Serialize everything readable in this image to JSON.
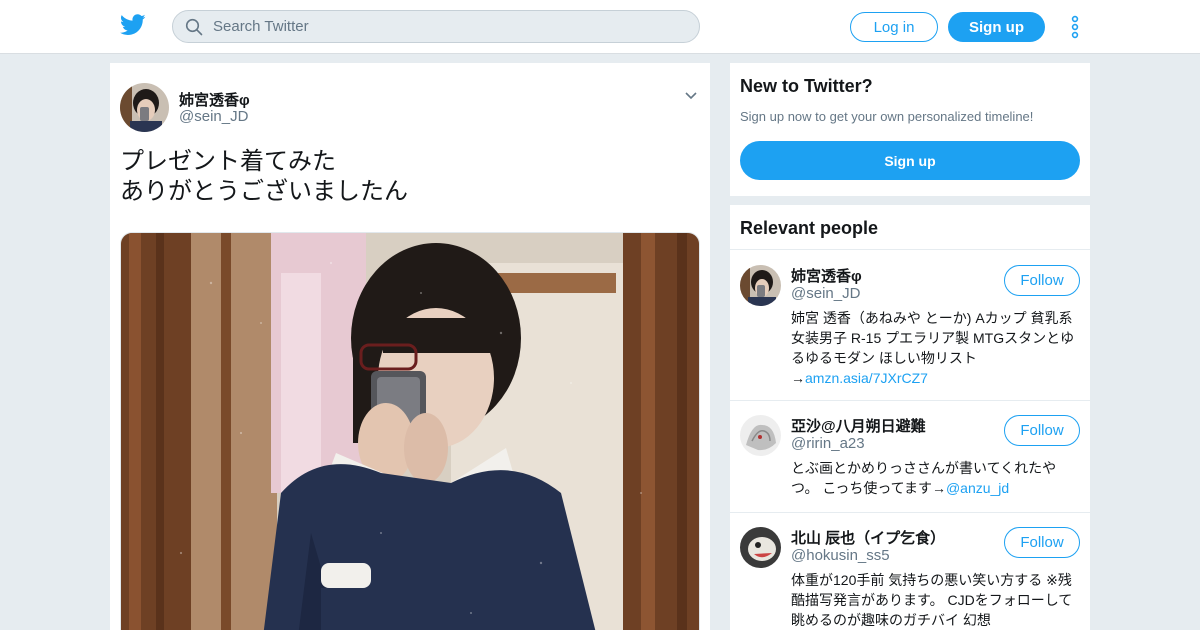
{
  "colors": {
    "brand": "#1da1f2",
    "background": "#e6ecf0",
    "text": "#14171a",
    "muted": "#657786"
  },
  "header": {
    "logo_icon": "twitter-bird-icon",
    "search_placeholder": "Search Twitter",
    "login_label": "Log in",
    "signup_label": "Sign up",
    "more_icon": "more-vertical-icon"
  },
  "tweet": {
    "author_name": "姉宮透香φ",
    "author_handle": "@sein_JD",
    "text": "プレゼント着てみた\nありがとうございましたん",
    "menu_icon": "chevron-down-icon"
  },
  "signup_card": {
    "title": "New to Twitter?",
    "subtitle": "Sign up now to get your own personalized timeline!",
    "button_label": "Sign up"
  },
  "relevant_people": {
    "title": "Relevant people",
    "people": [
      {
        "name": "姉宮透香φ",
        "handle": "@sein_JD",
        "follow_label": "Follow",
        "bio_text": "姉宮 透香（あねみや とーか) Aカップ 貧乳系女装男子 R-15 プエラリア製 MTGスタンとゆるゆるモダン ほしい物リスト→",
        "bio_link": "amzn.asia/7JXrCZ7"
      },
      {
        "name": "亞沙@八月朔日避難",
        "handle": "@ririn_a23",
        "follow_label": "Follow",
        "bio_text": "とぶ画とかめりっささんが書いてくれたやつ。 こっち使ってます→",
        "bio_link": "@anzu_jd"
      },
      {
        "name": "北山 辰也（イプ乞食）",
        "handle": "@hokusin_ss5",
        "follow_label": "Follow",
        "bio_text": "体重が120手前 気持ちの悪い笑い方する ※残酷描写発言があります。 CJDをフォローして眺めるのが趣味のガチバイ 幻想",
        "bio_link": ""
      }
    ]
  }
}
